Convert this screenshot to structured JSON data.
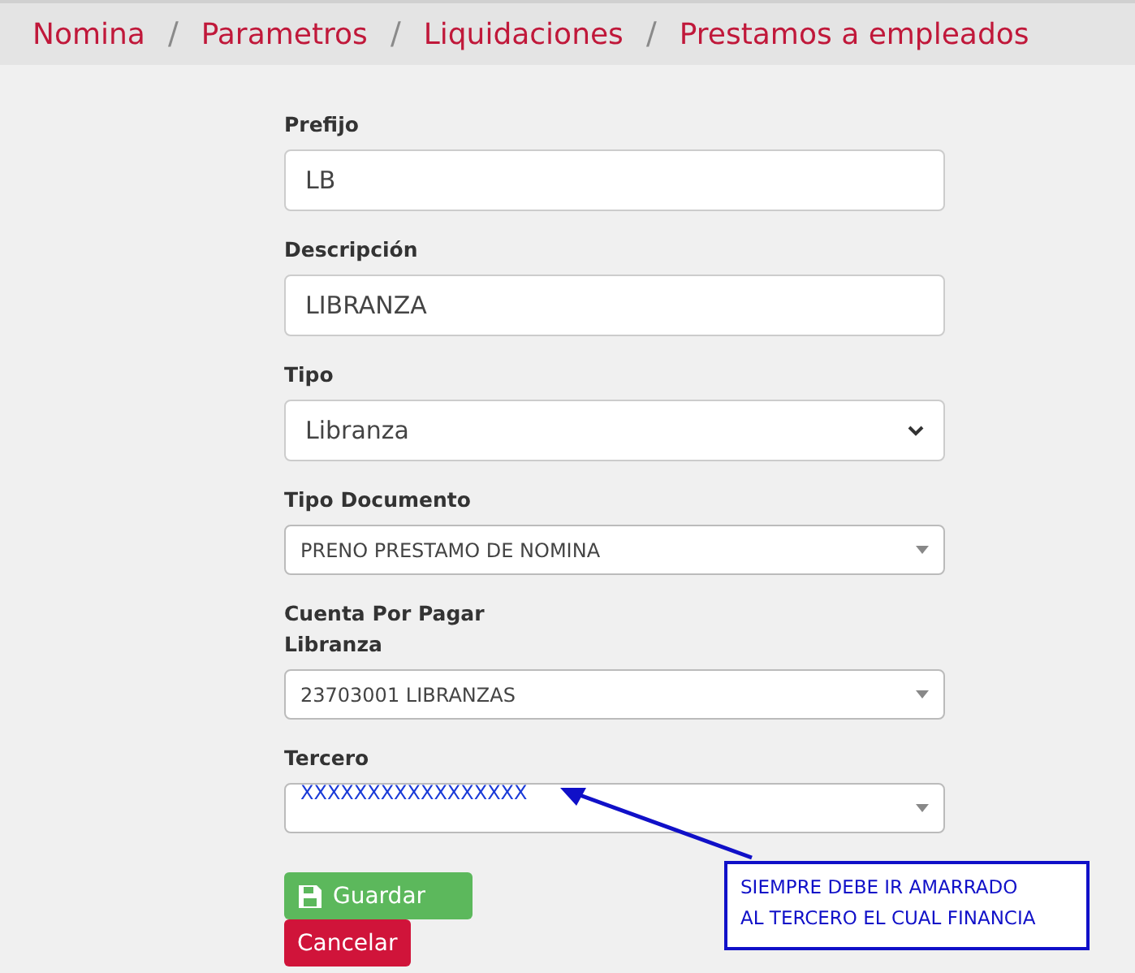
{
  "breadcrumb": {
    "items": [
      "Nomina",
      "Parametros",
      "Liquidaciones",
      "Prestamos a empleados"
    ],
    "separators": [
      "/",
      "/",
      "/"
    ]
  },
  "fields": [
    {
      "label": "Prefijo",
      "kind": "input",
      "value": "LB"
    },
    {
      "label": "Descripción",
      "kind": "input",
      "value": "LIBRANZA"
    },
    {
      "label": "Tipo",
      "kind": "select",
      "value": "Libranza"
    },
    {
      "label": "Tipo Documento",
      "kind": "select2",
      "value": "PRENO PRESTAMO DE NOMINA"
    },
    {
      "label": "Cuenta Por Pagar Libranza",
      "kind": "select2",
      "value": "23703001 LIBRANZAS"
    },
    {
      "label": "Tercero",
      "kind": "select2",
      "value": "XXXXXXXXXXXXXXXXX",
      "redacted": true
    }
  ],
  "buttons": [
    {
      "label": "Guardar",
      "kind": "save"
    },
    {
      "label": "Cancelar",
      "kind": "cancel"
    }
  ],
  "annotation": {
    "lines": [
      "SIEMPRE DEBE IR AMARRADO",
      "AL TERCERO EL CUAL FINANCIA"
    ]
  }
}
